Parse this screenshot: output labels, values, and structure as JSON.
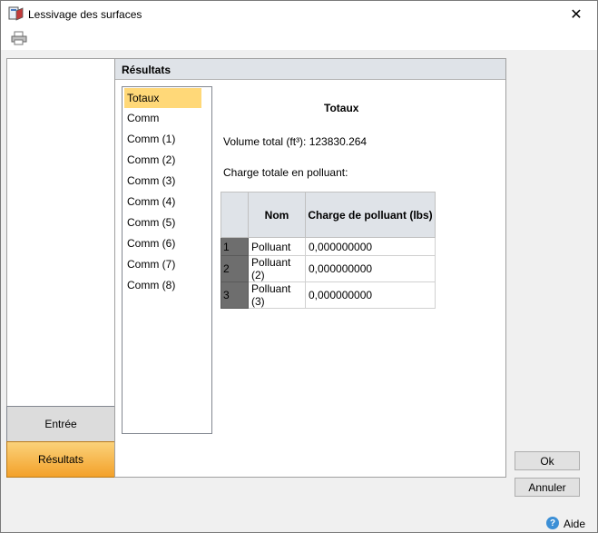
{
  "window": {
    "title": "Lessivage des surfaces",
    "close_glyph": "✕"
  },
  "toolbar": {
    "print_icon": "printer-icon"
  },
  "nav": {
    "entree_label": "Entrée",
    "resultats_label": "Résultats"
  },
  "main": {
    "header": "Résultats",
    "list_items": [
      "Totaux",
      "Comm",
      "Comm (1)",
      "Comm (2)",
      "Comm (3)",
      "Comm (4)",
      "Comm (5)",
      "Comm (6)",
      "Comm (7)",
      "Comm (8)"
    ],
    "selected_item": "Totaux",
    "content_title": "Totaux",
    "volume_text": "Volume total (ft³): 123830.264",
    "charge_text": "Charge totale en polluant:",
    "table": {
      "headers": [
        "Nom",
        "Charge de polluant (lbs)"
      ],
      "rows": [
        {
          "num": "1",
          "nom": "Polluant",
          "charge": "0,000000000"
        },
        {
          "num": "2",
          "nom": "Polluant (2)",
          "charge": "0,000000000"
        },
        {
          "num": "3",
          "nom": "Polluant (3)",
          "charge": "0,000000000"
        }
      ]
    }
  },
  "buttons": {
    "ok": "Ok",
    "annuler": "Annuler"
  },
  "footer": {
    "help_label": "Aide",
    "help_glyph": "?"
  },
  "colors": {
    "selected": "#ffd878",
    "active_nav": "#f3a12a",
    "header_bg": "#dfe3e8"
  }
}
